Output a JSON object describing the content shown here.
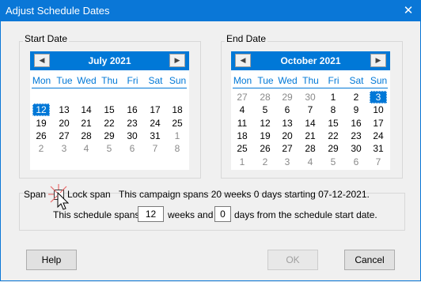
{
  "window": {
    "title": "Adjust Schedule Dates",
    "close_icon": "close-icon"
  },
  "start": {
    "label": "Start Date",
    "month": "July 2021",
    "dows": [
      "Mon",
      "Tue",
      "Wed",
      "Thu",
      "Fri",
      "Sat",
      "Sun"
    ],
    "weeks": [
      [
        "",
        "",
        "",
        "",
        "",
        "",
        ""
      ],
      [
        "12",
        "13",
        "14",
        "15",
        "16",
        "17",
        "18"
      ],
      [
        "19",
        "20",
        "21",
        "22",
        "23",
        "24",
        "25"
      ],
      [
        "26",
        "27",
        "28",
        "29",
        "30",
        "31",
        "1"
      ],
      [
        "2",
        "3",
        "4",
        "5",
        "6",
        "7",
        "8"
      ]
    ],
    "grey": [
      [
        3,
        6
      ],
      [
        4,
        0
      ],
      [
        4,
        1
      ],
      [
        4,
        2
      ],
      [
        4,
        3
      ],
      [
        4,
        4
      ],
      [
        4,
        5
      ],
      [
        4,
        6
      ]
    ],
    "selected": [
      1,
      0
    ]
  },
  "end": {
    "label": "End Date",
    "month": "October 2021",
    "dows": [
      "Mon",
      "Tue",
      "Wed",
      "Thu",
      "Fri",
      "Sat",
      "Sun"
    ],
    "weeks": [
      [
        "27",
        "28",
        "29",
        "30",
        "1",
        "2",
        "3"
      ],
      [
        "4",
        "5",
        "6",
        "7",
        "8",
        "9",
        "10"
      ],
      [
        "11",
        "12",
        "13",
        "14",
        "15",
        "16",
        "17"
      ],
      [
        "18",
        "19",
        "20",
        "21",
        "22",
        "23",
        "24"
      ],
      [
        "25",
        "26",
        "27",
        "28",
        "29",
        "30",
        "31"
      ],
      [
        "1",
        "2",
        "3",
        "4",
        "5",
        "6",
        "7"
      ]
    ],
    "grey": [
      [
        0,
        0
      ],
      [
        0,
        1
      ],
      [
        0,
        2
      ],
      [
        0,
        3
      ],
      [
        5,
        0
      ],
      [
        5,
        1
      ],
      [
        5,
        2
      ],
      [
        5,
        3
      ],
      [
        5,
        4
      ],
      [
        5,
        5
      ],
      [
        5,
        6
      ]
    ],
    "selected": [
      0,
      6
    ]
  },
  "span": {
    "label": "Span",
    "lock_label": "Lock span",
    "info": "This campaign spans 20 weeks 0 days starting 07-12-2021.",
    "prefix": "This schedule spans",
    "weeks_value": "12",
    "middle": "weeks and",
    "days_value": "0",
    "suffix": "days from the schedule start date."
  },
  "buttons": {
    "help": "Help",
    "ok": "OK",
    "cancel": "Cancel"
  }
}
